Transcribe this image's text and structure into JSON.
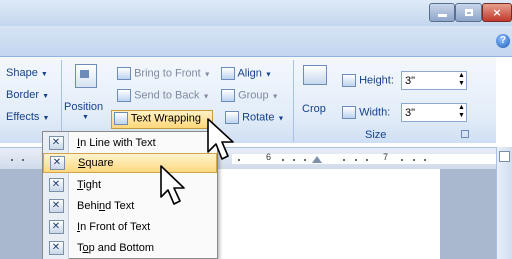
{
  "ribbon": {
    "shape_label": "Shape",
    "border_label": "Border",
    "effects_label": "Effects",
    "position_label": "Position",
    "bring_to_front": "Bring to Front",
    "send_to_back": "Send to Back",
    "text_wrapping": "Text Wrapping",
    "align": "Align",
    "group": "Group",
    "rotate": "Rotate",
    "crop": "Crop",
    "height_label": "Height:",
    "height_value": "3\"",
    "width_label": "Width:",
    "width_value": "3\"",
    "size_group": "Size"
  },
  "ruler": {
    "mark_6": "6",
    "mark_7": "7"
  },
  "menu": {
    "items": [
      {
        "before": "",
        "u": "I",
        "after": "n Line with Text"
      },
      {
        "before": "",
        "u": "S",
        "after": "quare"
      },
      {
        "before": "",
        "u": "T",
        "after": "ight"
      },
      {
        "before": "Behi",
        "u": "n",
        "after": "d Text"
      },
      {
        "before": "",
        "u": "I",
        "after": "n Front of Text"
      },
      {
        "before": "T",
        "u": "o",
        "after": "p and Bottom"
      }
    ]
  }
}
